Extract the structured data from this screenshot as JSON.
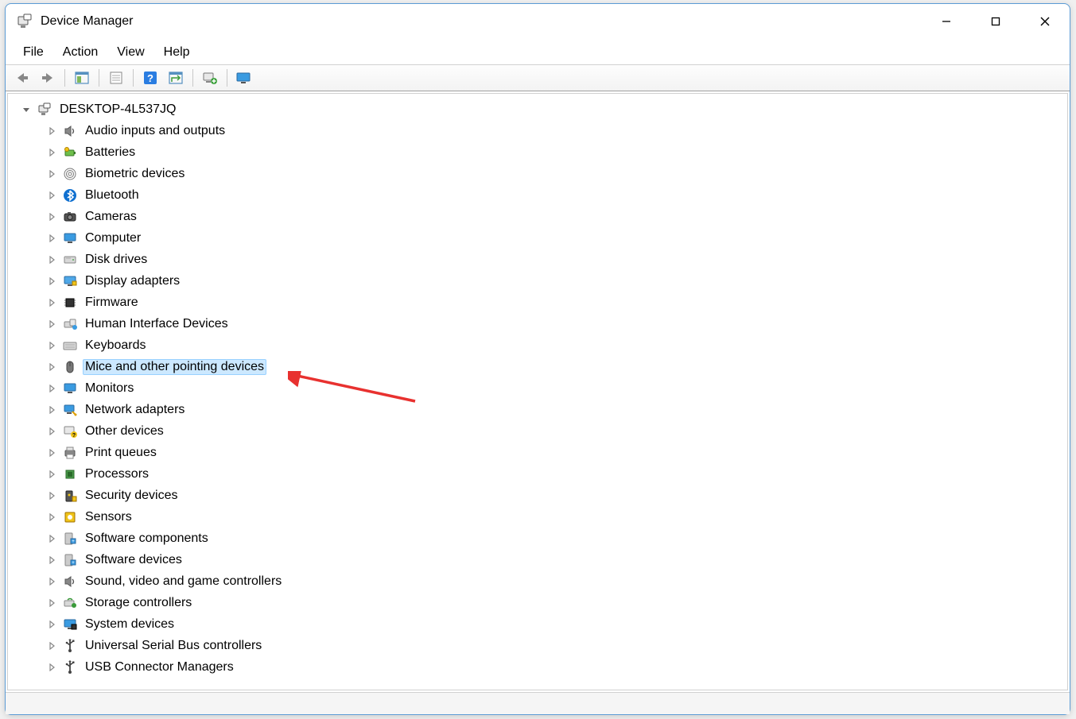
{
  "window": {
    "title": "Device Manager"
  },
  "menu": {
    "file": "File",
    "action": "Action",
    "view": "View",
    "help": "Help"
  },
  "tree": {
    "root": "DESKTOP-4L537JQ",
    "selected_index": 12,
    "categories": [
      {
        "label": "Audio inputs and outputs",
        "icon": "speaker"
      },
      {
        "label": "Batteries",
        "icon": "battery"
      },
      {
        "label": "Biometric devices",
        "icon": "fingerprint"
      },
      {
        "label": "Bluetooth",
        "icon": "bluetooth"
      },
      {
        "label": "Cameras",
        "icon": "camera"
      },
      {
        "label": "Computer",
        "icon": "monitor"
      },
      {
        "label": "Disk drives",
        "icon": "disk"
      },
      {
        "label": "Display adapters",
        "icon": "display"
      },
      {
        "label": "Firmware",
        "icon": "chip"
      },
      {
        "label": "Human Interface Devices",
        "icon": "hid"
      },
      {
        "label": "Keyboards",
        "icon": "keyboard"
      },
      {
        "label": "Mice and other pointing devices",
        "icon": "mouse"
      },
      {
        "label": "Monitors",
        "icon": "monitor"
      },
      {
        "label": "Network adapters",
        "icon": "network"
      },
      {
        "label": "Other devices",
        "icon": "unknown"
      },
      {
        "label": "Print queues",
        "icon": "printer"
      },
      {
        "label": "Processors",
        "icon": "cpu"
      },
      {
        "label": "Security devices",
        "icon": "security"
      },
      {
        "label": "Sensors",
        "icon": "sensor"
      },
      {
        "label": "Software components",
        "icon": "software"
      },
      {
        "label": "Software devices",
        "icon": "software"
      },
      {
        "label": "Sound, video and game controllers",
        "icon": "speaker"
      },
      {
        "label": "Storage controllers",
        "icon": "storage"
      },
      {
        "label": "System devices",
        "icon": "system"
      },
      {
        "label": "Universal Serial Bus controllers",
        "icon": "usb"
      },
      {
        "label": "USB Connector Managers",
        "icon": "usb"
      }
    ]
  },
  "toolbar": {
    "back": "Back",
    "forward": "Forward",
    "show_hide": "Show/Hide Console Tree",
    "properties": "Properties",
    "help": "Help",
    "scan": "Scan for hardware changes",
    "add_legacy": "Add legacy hardware",
    "devices": "Devices and Printers"
  },
  "win_controls": {
    "minimize": "Minimize",
    "maximize": "Maximize",
    "close": "Close"
  },
  "annotation": {
    "target": "Mice and other pointing devices"
  }
}
